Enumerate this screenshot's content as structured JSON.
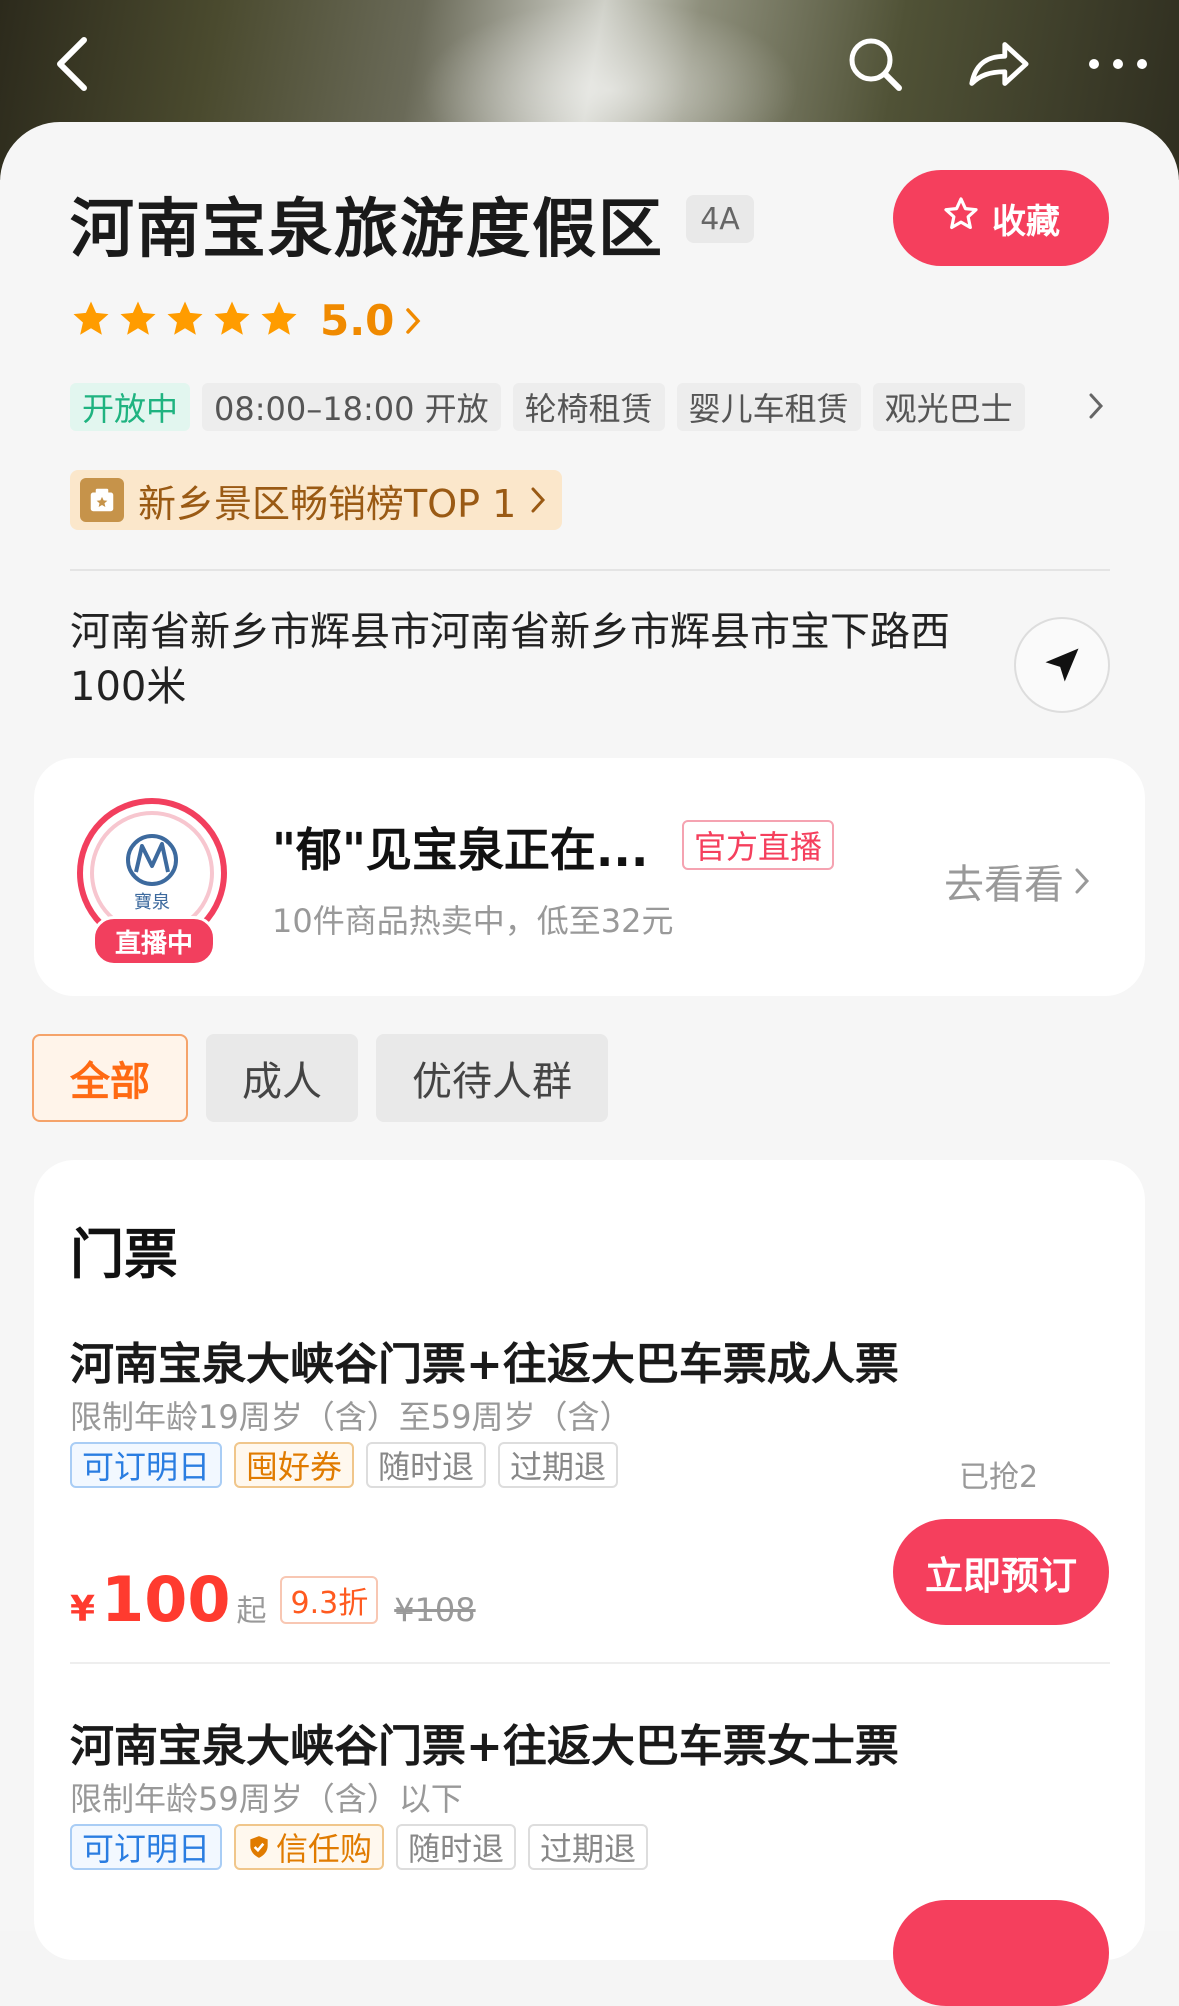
{
  "header": {
    "back_icon": "back-arrow-icon",
    "search_icon": "search-icon",
    "share_icon": "share-icon",
    "more_icon": "more-icon"
  },
  "scenic": {
    "title": "河南宝泉旅游度假区",
    "grade": "4A",
    "favorite_label": "收藏",
    "rating": "5.0",
    "rating_stars": 5,
    "tags": [
      "开放中",
      "08:00–18:00 开放",
      "轮椅租赁",
      "婴儿车租赁",
      "观光巴士"
    ],
    "rank_label": "新乡景区畅销榜TOP 1",
    "address": "河南省新乡市辉县市河南省新乡市辉县市宝下路西100米"
  },
  "live": {
    "title": "\"郁\"见宝泉正在...",
    "official_tag": "官方直播",
    "subtitle": "10件商品热卖中，低至32元",
    "badge": "直播中",
    "cta": "去看看",
    "avatar_text": "寶泉"
  },
  "filters": [
    "全部",
    "成人",
    "优待人群"
  ],
  "tickets": {
    "section_title": "门票",
    "items": [
      {
        "title": "河南宝泉大峡谷门票+往返大巴车票成人票",
        "restriction": "限制年龄19周岁（含）至59周岁（含）",
        "tags": [
          "可订明日",
          "囤好券",
          "随时退",
          "过期退"
        ],
        "sold": "已抢2",
        "currency": "¥",
        "price": "100",
        "price_suffix": "起",
        "discount": "9.3折",
        "original_price": "¥108",
        "book_label": "立即预订"
      },
      {
        "title": "河南宝泉大峡谷门票+往返大巴车票女士票",
        "restriction": "限制年龄59周岁（含）以下",
        "tags": [
          "可订明日",
          "信任购",
          "随时退",
          "过期退"
        ]
      }
    ]
  },
  "colors": {
    "accent": "#f53f5d",
    "price": "#ff3b2f",
    "rating": "#f08a00",
    "open": "#1fb380",
    "filter_active": "#ff6a13"
  }
}
